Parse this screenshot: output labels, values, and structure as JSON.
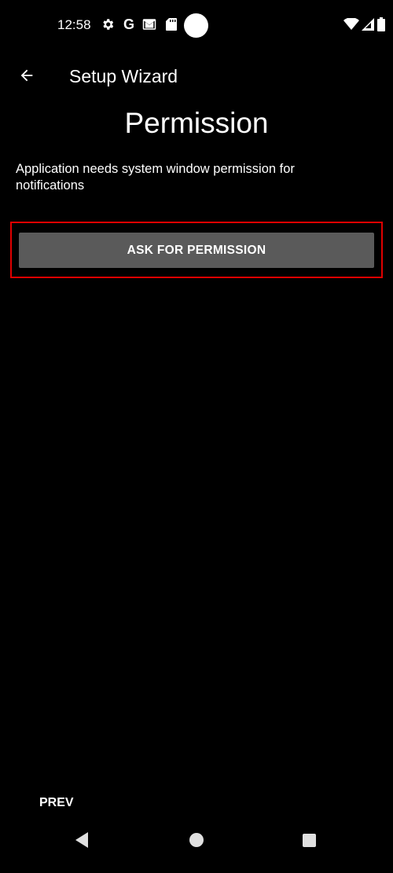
{
  "status_bar": {
    "time": "12:58",
    "left_icons": [
      "gear-icon",
      "google-icon",
      "gmail-icon",
      "sd-card-icon"
    ],
    "right_icons": [
      "wifi-icon",
      "signal-icon",
      "battery-icon"
    ],
    "google_letter": "G"
  },
  "toolbar": {
    "back_icon": "arrow-left-icon",
    "title": "Setup Wizard"
  },
  "page": {
    "title": "Permission",
    "description": "Application needs system window permission for notifications",
    "ask_button_label": "ASK FOR PERMISSION",
    "prev_label": "PREV"
  },
  "nav_bar": {
    "icons": [
      "nav-back-icon",
      "nav-home-icon",
      "nav-recents-icon"
    ]
  },
  "colors": {
    "background": "#000000",
    "button": "#5a5a5a",
    "highlight": "#e00000",
    "text": "#ffffff"
  }
}
